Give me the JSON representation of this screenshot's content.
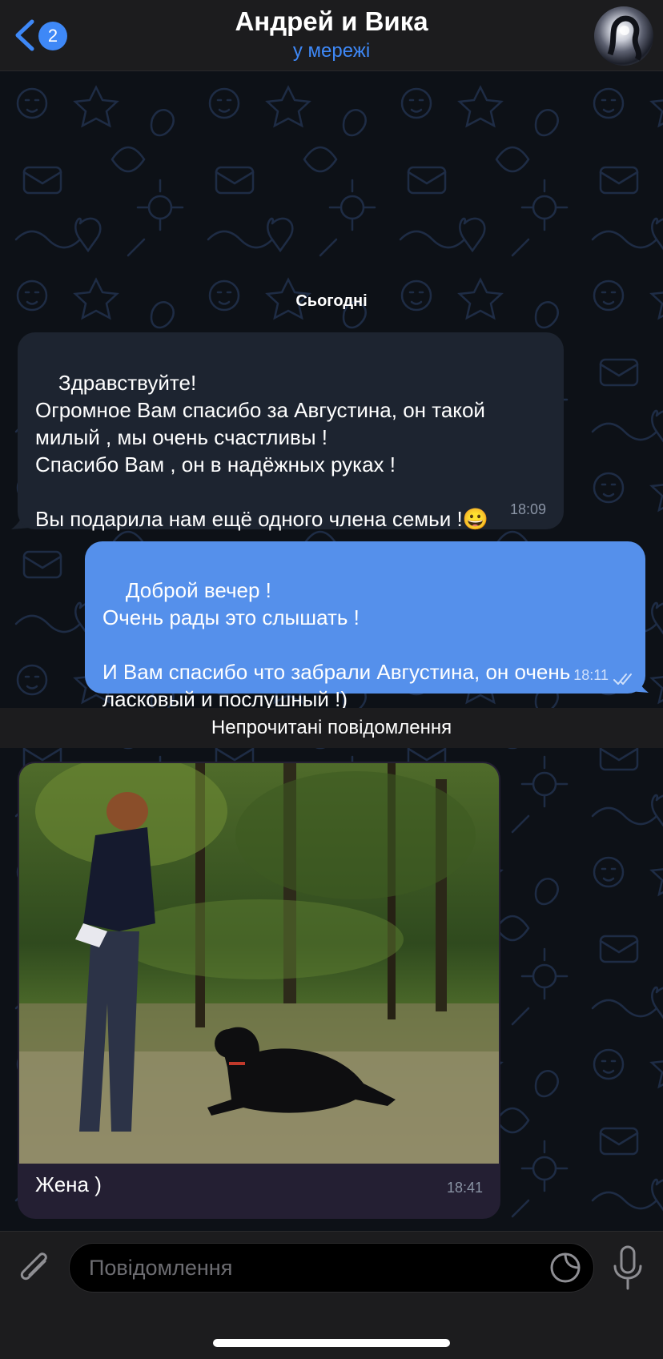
{
  "header": {
    "back_badge": "2",
    "title": "Андрей и Вика",
    "status": "у мережі"
  },
  "chat": {
    "date_label": "Сьогодні",
    "messages": [
      {
        "direction": "incoming",
        "text": "Здравствуйте!\nОгромное Вам спасибо за Августина, он такой милый , мы очень счастливы !\nСпасибо Вам , он в надёжных руках !\n\nВы подарила нам ещё одного члена семьи !😀",
        "time": "18:09"
      },
      {
        "direction": "outgoing",
        "text": "Доброй вечер !\nОчень рады это слышать !\n\nИ Вам спасибо что забрали Августина, он очень ласковый и послушный !)",
        "time": "18:11",
        "read": true
      }
    ],
    "unread_label": "Непрочитані повідомлення",
    "photo_message": {
      "direction": "incoming",
      "caption": "Жена )",
      "time": "18:41"
    }
  },
  "composer": {
    "placeholder": "Повідомлення"
  },
  "colors": {
    "accent": "#3e88f7",
    "outgoing_bubble": "#5590eb",
    "incoming_bubble": "#1d2430",
    "bar": "#1c1c1e"
  },
  "icons": [
    "chevron-left-icon",
    "paperclip-icon",
    "sticker-icon",
    "microphone-icon",
    "double-check-icon"
  ]
}
